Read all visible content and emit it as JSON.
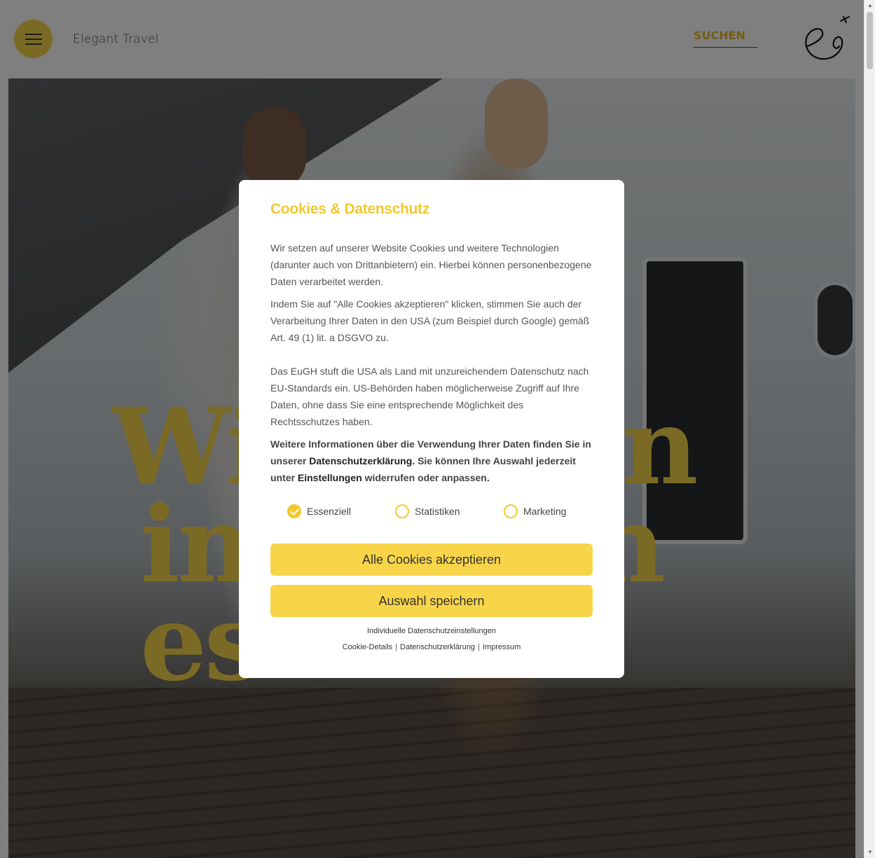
{
  "header": {
    "site_name": "Elegant Travel",
    "search_label": "SUCHEN",
    "accent_color": "#f7d44a"
  },
  "hero": {
    "headline_line1": "Wir lieben",
    "headline_line2": "im Leben es"
  },
  "cookie_modal": {
    "title": "Cookies & Datenschutz",
    "paragraph1": "Wir setzen auf unserer Website Cookies und weitere Technologien (darunter auch von Drittanbietern) ein. Hierbei können personenbezogene Daten verarbeitet werden.",
    "paragraph2": "Indem Sie auf \"Alle Cookies akzeptieren\" klicken, stimmen Sie auch der Verarbeitung Ihrer Daten in den USA (zum Beispiel durch Google) gemäß Art. 49 (1) lit. a DSGVO zu.",
    "paragraph3": "Das EuGH stuft die USA als Land mit unzureichendem Datenschutz nach EU-Standards ein. US-Behörden haben möglicherweise Zugriff auf Ihre Daten, ohne dass Sie eine entsprechende Möglichkeit des Rechtsschutzes haben.",
    "info_part1": "Weitere Informationen über die Verwendung Ihrer Daten finden Sie in unserer ",
    "info_link_privacy": "Datenschutzerklärung",
    "info_part2": ". Sie können Ihre Auswahl jederzeit unter ",
    "info_link_settings": "Einstellungen",
    "info_part3": " widerrufen oder anpassen.",
    "options": [
      {
        "label": "Essenziell",
        "checked": true
      },
      {
        "label": "Statistiken",
        "checked": false
      },
      {
        "label": "Marketing",
        "checked": false
      }
    ],
    "accept_all_label": "Alle Cookies akzeptieren",
    "save_selection_label": "Auswahl speichern",
    "individual_settings_label": "Individuelle Datenschutzeinstellungen",
    "footer_links": [
      "Cookie-Details",
      "Datenschutzerklärung",
      "Impressum"
    ],
    "footer_separator": "|"
  }
}
